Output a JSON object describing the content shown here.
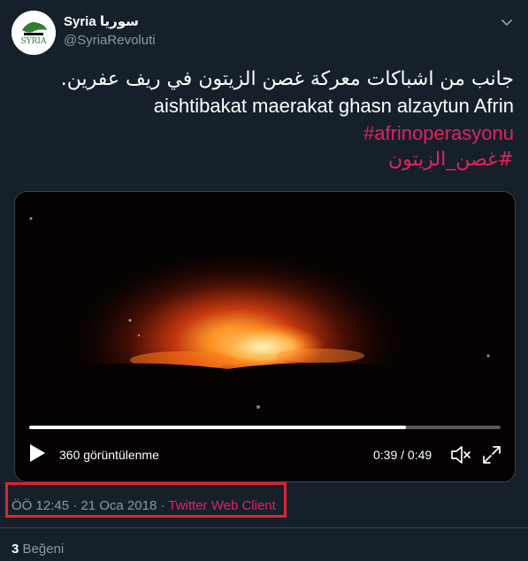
{
  "tweet": {
    "author": {
      "display_name": "Syria سوريا",
      "handle": "@SyriaRevoluti",
      "avatar_text": "SYRIA"
    },
    "text": {
      "line_arabic": "جانب من اشباكات معركة غصن الزيتون في ريف عفرين.",
      "line_latin": "aishtibakat maerakat ghasn alzaytun Afrin",
      "hashtag_1": "#afrinoperasyonu",
      "hashtag_2": "#غصن_الزيتون"
    },
    "video": {
      "views": "360 görüntülenme",
      "time": "0:39 / 0:49",
      "progress": 0.8
    },
    "meta": {
      "time": "ÖÖ 12:45",
      "date": "21 Oca 2018",
      "separator": "·",
      "client": "Twitter Web Client"
    },
    "likes": {
      "count": "3",
      "label": "Beğeni"
    }
  },
  "colors": {
    "background": "#15202b",
    "accent": "#e0245e",
    "muted": "#8899a6",
    "highlight_box": "#e0232c"
  },
  "icons": [
    "chevron-down-icon",
    "play-icon",
    "volume-icon",
    "fullscreen-icon"
  ]
}
